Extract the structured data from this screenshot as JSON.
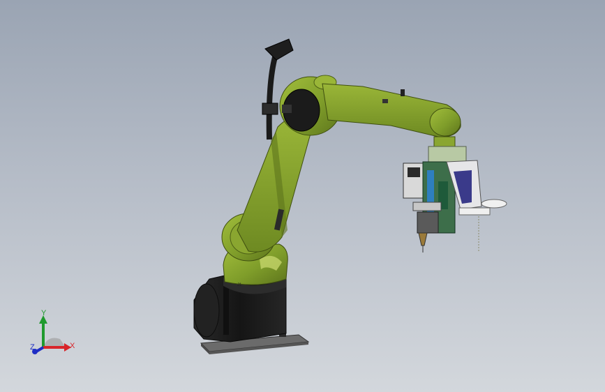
{
  "viewport": {
    "background_top": "#9aa4b3",
    "background_bottom": "#d3d7dc"
  },
  "robot": {
    "body_color": "#7f9d2a",
    "base_color": "#1e1e1e",
    "plate_color": "#5d5d5d"
  },
  "triad": {
    "x_label": "X",
    "y_label": "Y",
    "z_label": "Z",
    "x_color": "#d8252a",
    "y_color": "#1f9a2e",
    "z_color": "#1f2ec4"
  }
}
